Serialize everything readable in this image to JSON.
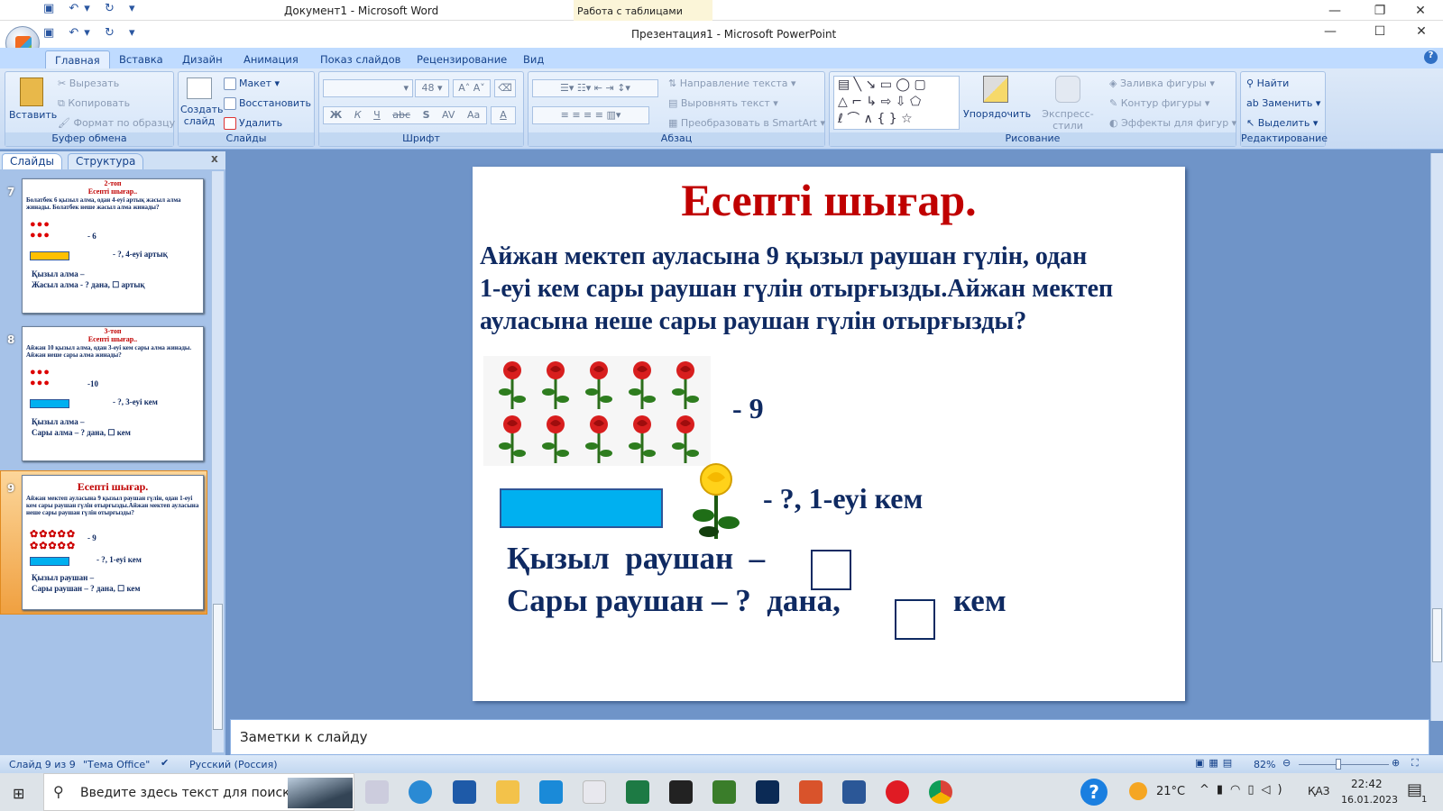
{
  "word_window": {
    "title": "Документ1 - Microsoft Word",
    "context_tab": "Работа с таблицами"
  },
  "ppt_window": {
    "title": "Презентация1 - Microsoft PowerPoint"
  },
  "ribbon_tabs": [
    "Главная",
    "Вставка",
    "Дизайн",
    "Анимация",
    "Показ слайдов",
    "Рецензирование",
    "Вид"
  ],
  "ribbon": {
    "clipboard": {
      "label": "Буфер обмена",
      "paste": "Вставить",
      "cut": "Вырезать",
      "copy": "Копировать",
      "format_painter": "Формат по образцу"
    },
    "slides": {
      "label": "Слайды",
      "new_slide": "Создать слайд",
      "layout": "Макет",
      "reset": "Восстановить",
      "delete": "Удалить"
    },
    "font": {
      "label": "Шрифт",
      "font_name": "",
      "font_size": "48",
      "bold": "Ж",
      "italic": "К",
      "underline": "Ч",
      "strike": "abc",
      "shadow": "S",
      "spacing": "AV",
      "case": "Aa",
      "color": "A"
    },
    "paragraph": {
      "label": "Абзац",
      "text_direction": "Направление текста",
      "align_text": "Выровнять текст",
      "smartart": "Преобразовать в SmartArt"
    },
    "drawing": {
      "label": "Рисование",
      "arrange": "Упорядочить",
      "quick_styles": "Экспресс-стили",
      "fill": "Заливка фигуры",
      "outline": "Контур фигуры",
      "effects": "Эффекты для фигур"
    },
    "editing": {
      "label": "Редактирование",
      "find": "Найти",
      "replace": "Заменить",
      "select": "Выделить"
    }
  },
  "panel": {
    "tabs": [
      "Слайды",
      "Структура"
    ],
    "close": "x"
  },
  "thumbnails": [
    {
      "number": "7",
      "group": "2-топ",
      "title": "Есепті шығар..",
      "text": "Болатбек 6 қызыл алма, одан 4-еуі артық жасыл алма жинады. Болатбек неше жасыл алма жинады?",
      "count": "- 6",
      "bar_color": "#ffc000",
      "hint": "- ?, 4-еуі артық",
      "line1": "Қызыл алма –",
      "line2a": "Жасыл алма - ? дана,",
      "line2b": "артық"
    },
    {
      "number": "8",
      "group": "3-топ",
      "title": "Есепті шығар..",
      "text": "Айжан 10 қызыл алма, одан 3-еуі кем сары алма жинады. Айжан неше сары алма жинады?",
      "count": "-10",
      "bar_color": "#00b0f0",
      "hint": "- ?, 3-еуі кем",
      "line1": "Қызыл алма –",
      "line2a": "Сары алма – ? дана,",
      "line2b": "кем"
    },
    {
      "number": "9",
      "group": "",
      "title": "Есепті шығар.",
      "text": "Айжан мектеп ауласына 9 қызыл раушан гүлін, одан 1-еуі кем сары раушан гүлін отырғызды.Айжан мектеп ауласына неше сары раушан гүлін отырғызды?",
      "count": "- 9",
      "bar_color": "#00b0f0",
      "hint": "- ?, 1-еуі кем",
      "line1": "Қызыл раушан –",
      "line2a": "Сары раушан – ? дана,",
      "line2b": "кем"
    }
  ],
  "slide": {
    "title": "Есепті шығар.",
    "problem_lines": [
      "Айжан мектеп ауласына 9 қызыл раушан гүлін, одан",
      "1-еуі кем сары раушан гүлін отырғызды.Айжан мектеп",
      "ауласына неше сары раушан гүлін отырғызды?"
    ],
    "red_rose_count": 10,
    "red_label": "- 9",
    "yellow_label": "- ?, 1-еуі кем",
    "line1": "Қызыл  раушан  –",
    "line2a": "Сары раушан – ?  дана,",
    "line2b": "кем",
    "colors": {
      "title": "#c00000",
      "text": "#0f2a62",
      "bar": "#00b0f0"
    }
  },
  "notes": {
    "placeholder": "Заметки к слайду"
  },
  "status": {
    "slide": "Слайд 9 из 9",
    "theme": "\"Тема Office\"",
    "language": "Русский (Россия)",
    "zoom": "82%",
    "zoom_percent": 82
  },
  "taskbar": {
    "search_placeholder": "Введите здесь текст для поиска",
    "weather": "21°C",
    "lang": "ҚАЗ",
    "time": "22:42",
    "date": "16.01.2023",
    "notif_count": "1"
  }
}
